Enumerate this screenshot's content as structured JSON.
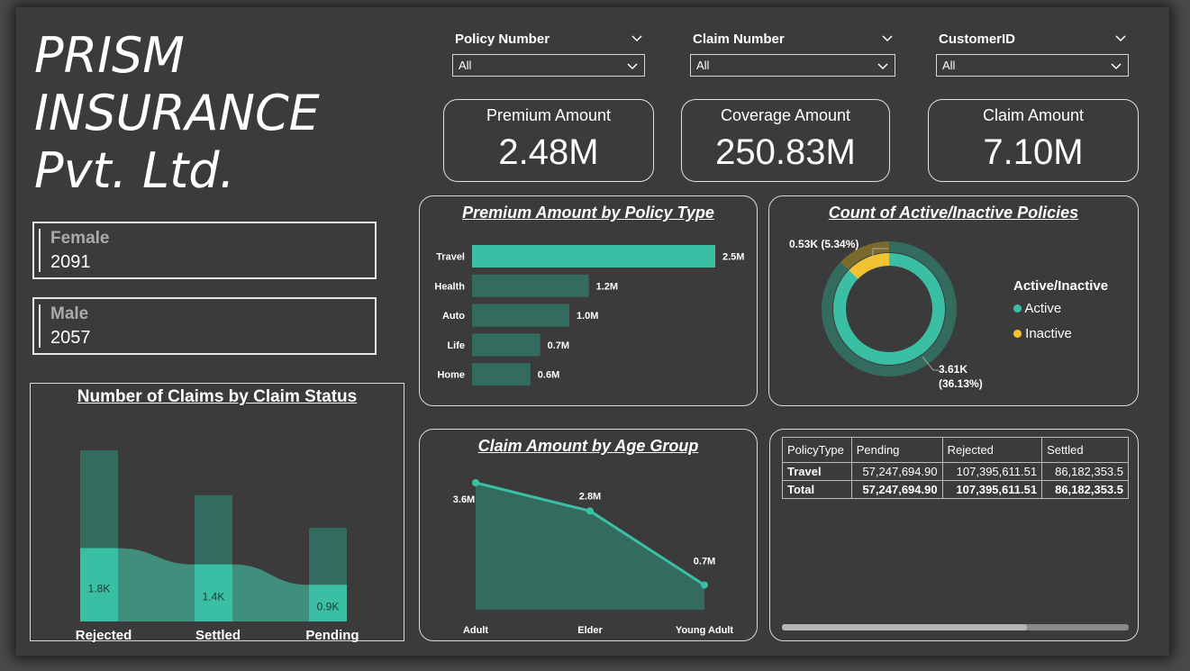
{
  "company_title": "PRISM INSURANCE Pvt. Ltd.",
  "gender": {
    "female": {
      "label": "Female",
      "value": "2091"
    },
    "male": {
      "label": "Male",
      "value": "2057"
    }
  },
  "slicers": {
    "policy": {
      "title": "Policy Number",
      "value": "All"
    },
    "claim": {
      "title": "Claim Number",
      "value": "All"
    },
    "customer": {
      "title": "CustomerID",
      "value": "All"
    }
  },
  "kpis": {
    "premium": {
      "label": "Premium Amount",
      "value": "2.48M"
    },
    "coverage": {
      "label": "Coverage Amount",
      "value": "250.83M"
    },
    "claim": {
      "label": "Claim Amount",
      "value": "7.10M"
    }
  },
  "icons": {
    "chevron": "chevron-down-icon",
    "dropdown": "dropdown-arrow-icon"
  },
  "colors": {
    "accent": "#3bbfa4",
    "dark_series": "#336b5f",
    "inactive": "#f2c233",
    "background": "#3b3b3b"
  },
  "chart_data": [
    {
      "id": "premium_by_policy",
      "type": "bar",
      "orientation": "horizontal",
      "title": "Premium Amount by Policy Type",
      "categories": [
        "Travel",
        "Health",
        "Auto",
        "Life",
        "Home"
      ],
      "values": [
        2.5,
        1.2,
        1.0,
        0.7,
        0.6
      ],
      "labels": [
        "2.5M",
        "1.2M",
        "1.0M",
        "0.7M",
        "0.6M"
      ],
      "xlim": [
        0,
        2.5
      ]
    },
    {
      "id": "active_inactive",
      "type": "pie",
      "donut": true,
      "title": "Count of Active/Inactive Policies",
      "legend_title": "Active/Inactive",
      "legend_position": "right",
      "slices": [
        {
          "name": "Active",
          "value": 3.61,
          "label": "3.61K",
          "pct": "(36.13%)"
        },
        {
          "name": "Inactive",
          "value": 0.53,
          "label": "0.53K (5.34%)"
        }
      ]
    },
    {
      "id": "claims_by_status",
      "type": "bar",
      "title": "Number of Claims by Claim Status",
      "categories": [
        "Rejected",
        "Settled",
        "Pending"
      ],
      "series": [
        {
          "values": [
            1.8,
            1.4,
            0.9
          ],
          "labels": [
            "1.8K",
            "1.4K",
            "0.9K"
          ]
        }
      ],
      "background_values": [
        4.2,
        3.1,
        2.3
      ],
      "ylim": [
        0,
        4.2
      ]
    },
    {
      "id": "claim_by_age",
      "type": "area",
      "title": "Claim Amount by Age Group",
      "categories": [
        "Adult",
        "Elder",
        "Young Adult"
      ],
      "values": [
        3.6,
        2.8,
        0.7
      ],
      "labels": [
        "3.6M",
        "2.8M",
        "0.7M"
      ],
      "ylim": [
        0,
        3.6
      ]
    },
    {
      "id": "claims_matrix",
      "type": "table",
      "columns": [
        "PolicyType",
        "Pending",
        "Rejected",
        "Settled"
      ],
      "rows": [
        [
          "Travel",
          "57,247,694.90",
          "107,395,611.51",
          "86,182,353.5"
        ],
        [
          "Total",
          "57,247,694.90",
          "107,395,611.51",
          "86,182,353.5"
        ]
      ]
    }
  ]
}
